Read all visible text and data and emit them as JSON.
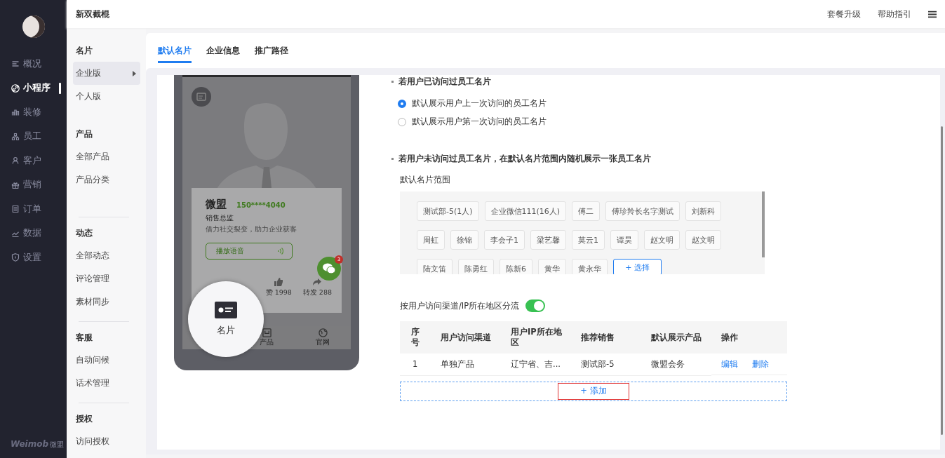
{
  "app": {
    "logo": "Weimob",
    "logo_sub": "微盟"
  },
  "rail": [
    {
      "label": "概况",
      "selected": false
    },
    {
      "label": "小程序",
      "selected": true
    },
    {
      "label": "装修",
      "selected": false
    },
    {
      "label": "员工",
      "selected": false
    },
    {
      "label": "客户",
      "selected": false
    },
    {
      "label": "营销",
      "selected": false
    },
    {
      "label": "订单",
      "selected": false
    },
    {
      "label": "数据",
      "selected": false
    },
    {
      "label": "设置",
      "selected": false
    }
  ],
  "topbar": {
    "title": "新双截棍",
    "links": [
      "套餐升级",
      "帮助指引"
    ]
  },
  "subnav": [
    {
      "title": "名片",
      "separated": false,
      "items": [
        {
          "label": "企业版",
          "selected": true
        },
        {
          "label": "个人版",
          "selected": false
        }
      ]
    },
    {
      "title": "产品",
      "separated": false,
      "items": [
        {
          "label": "全部产品",
          "selected": false
        },
        {
          "label": "产品分类",
          "selected": false
        }
      ]
    },
    {
      "title": "动态",
      "separated": true,
      "items": [
        {
          "label": "全部动态",
          "selected": false
        },
        {
          "label": "评论管理",
          "selected": false
        },
        {
          "label": "素材同步",
          "selected": false
        }
      ]
    },
    {
      "title": "客服",
      "separated": true,
      "items": [
        {
          "label": "自动问候",
          "selected": false
        },
        {
          "label": "话术管理",
          "selected": false
        }
      ]
    },
    {
      "title": "授权",
      "separated": true,
      "items": [
        {
          "label": "访问授权",
          "selected": false
        }
      ]
    }
  ],
  "tabs": [
    {
      "label": "默认名片",
      "selected": true
    },
    {
      "label": "企业信息",
      "selected": false
    },
    {
      "label": "推广路径",
      "selected": false
    }
  ],
  "preview": {
    "name": "微盟",
    "phone": "150****4040",
    "position": "销售总监",
    "slogan": "借力社交裂变，助力企业获客",
    "voice_button": "播放语音",
    "likes": "赞 1998",
    "shares": "转发 288",
    "chat_badge": "3",
    "tabbar": [
      "产品",
      "官网"
    ],
    "magnifier_label": "名片"
  },
  "visited": {
    "heading": "若用户已访问过员工名片",
    "options": [
      {
        "label": "默认展示用户上一次访问的员工名片",
        "selected": true
      },
      {
        "label": "默认展示用户第一次访问的员工名片",
        "selected": false
      }
    ]
  },
  "not_visited": {
    "heading": "若用户未访问过员工名片，在默认名片范围内随机展示一张员工名片",
    "range_label": "默认名片范围",
    "tags": [
      "测试部-5(1人)",
      "企业微信111(16人)",
      "傅二",
      "傅珍羚长名字测试",
      "刘新科",
      "周虹",
      "徐锦",
      "李会子1",
      "梁艺馨",
      "莫云1",
      "谭昊",
      "赵文明",
      "赵文明",
      "陆文笛",
      "陈勇红",
      "陈新6",
      "黄华",
      "黄永华"
    ],
    "select_button": "+ 选择"
  },
  "split": {
    "label": "按用户访问渠道/IP所在地区分流",
    "on": true
  },
  "table": {
    "columns": [
      "序号",
      "用户访问渠道",
      "用户IP所在地区",
      "推荐销售",
      "默认展示产品",
      "操作"
    ],
    "rows": [
      {
        "cells": [
          "1",
          "单独产品",
          "辽宁省、吉...",
          "测试部-5",
          "微盟会务"
        ],
        "actions": [
          "编辑",
          "删除"
        ]
      }
    ]
  },
  "add_button": "+ 添加"
}
